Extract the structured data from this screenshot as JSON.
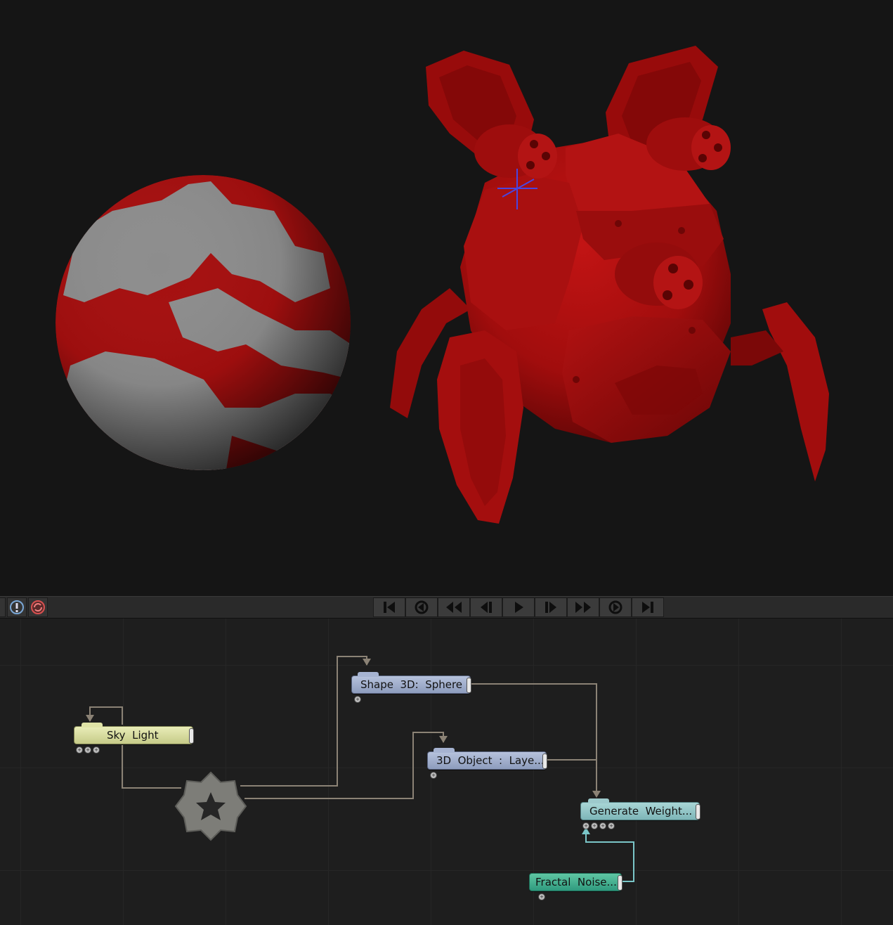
{
  "viewport": {
    "objects": [
      "sphere-mesh",
      "robot-mesh"
    ],
    "colors": {
      "background": "#151515",
      "mesh_red": "#a20c0c",
      "mesh_grey": "#8a8a8a",
      "crosshair": "#4a45e0"
    }
  },
  "toolbar": {
    "left_icons": [
      "panel-edge-icon",
      "info-icon",
      "refresh-icon"
    ],
    "transport": [
      "skip-to-start-icon",
      "previous-keyframe-icon",
      "rewind-icon",
      "step-back-icon",
      "play-icon",
      "step-forward-icon",
      "fast-forward-icon",
      "next-keyframe-icon",
      "skip-to-end-icon"
    ]
  },
  "graph": {
    "nodes": {
      "sky_light": {
        "label": "Sky  Light",
        "ports": [
          "+",
          "+",
          "+"
        ],
        "color": "#dfe3a6"
      },
      "sphere": {
        "label": "Shape  3D:  Sphere",
        "ports": [
          "+"
        ],
        "color": "#a6b3d1"
      },
      "object": {
        "label": "3D  Object  :  Laye...",
        "ports": [
          "+"
        ],
        "color": "#a6b3d1"
      },
      "weight": {
        "label": "Generate  Weight...",
        "ports": [
          "+",
          "+",
          "+",
          "+"
        ],
        "color": "#9dcacc"
      },
      "fractal": {
        "label": "Fractal  Noise...",
        "ports": [
          "+"
        ],
        "color": "#3fae8d"
      }
    },
    "root_icon": "gear-icon",
    "wire_color": "#8b8275"
  }
}
